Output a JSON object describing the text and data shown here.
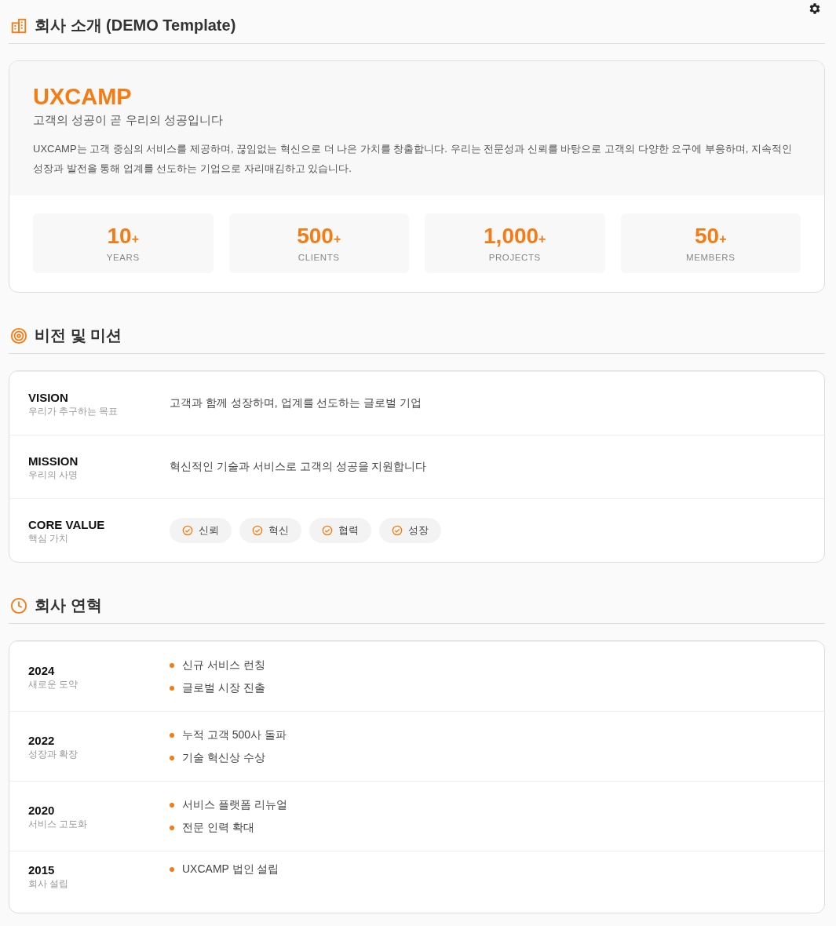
{
  "sections": [
    {
      "kind": "intro",
      "title": "회사 소개 (DEMO Template)",
      "brand": "UXCAMP",
      "tagline": "고객의 성공이 곧 우리의 성공입니다",
      "description": "UXCAMP는 고객 중심의 서비스를 제공하며, 끊임없는 혁신으로 더 나은 가치를 창출합니다. 우리는 전문성과 신뢰를 바탕으로 고객의 다양한 요구에 부응하며, 지속적인 성장과 발전을 통해 업계를 선도하는 기업으로 자리매김하고 있습니다.",
      "stats": [
        {
          "value": "10",
          "suffix": "+",
          "label": "YEARS"
        },
        {
          "value": "500",
          "suffix": "+",
          "label": "CLIENTS"
        },
        {
          "value": "1,000",
          "suffix": "+",
          "label": "PROJECTS"
        },
        {
          "value": "50",
          "suffix": "+",
          "label": "MEMBERS"
        }
      ]
    },
    {
      "kind": "vision",
      "title": "비전 및 미션",
      "rows": [
        {
          "kind": "text",
          "title": "VISION",
          "subtitle": "우리가 추구하는 목표",
          "text": "고객과 함께 성장하며, 업계를 선도하는 글로벌 기업"
        },
        {
          "kind": "text",
          "title": "MISSION",
          "subtitle": "우리의 사명",
          "text": "혁신적인 기술과 서비스로 고객의 성공을 지원합니다"
        },
        {
          "kind": "chips",
          "title": "CORE VALUE",
          "subtitle": "핵심 가치",
          "chips": [
            "신뢰",
            "혁신",
            "협력",
            "성장"
          ]
        }
      ]
    },
    {
      "kind": "history",
      "title": "회사 연혁",
      "rows": [
        {
          "year": "2024",
          "subtitle": "새로운 도약",
          "items": [
            "신규 서비스 런칭",
            "글로벌 시장 진출"
          ]
        },
        {
          "year": "2022",
          "subtitle": "성장과 확장",
          "items": [
            "누적 고객 500사 돌파",
            "기술 혁신상 수상"
          ]
        },
        {
          "year": "2020",
          "subtitle": "서비스 고도화",
          "items": [
            "서비스 플랫폼 리뉴얼",
            "전문 인력 확대"
          ]
        },
        {
          "year": "2015",
          "subtitle": "회사 설립",
          "items": [
            "UXCAMP 법인 설립"
          ]
        }
      ]
    }
  ]
}
